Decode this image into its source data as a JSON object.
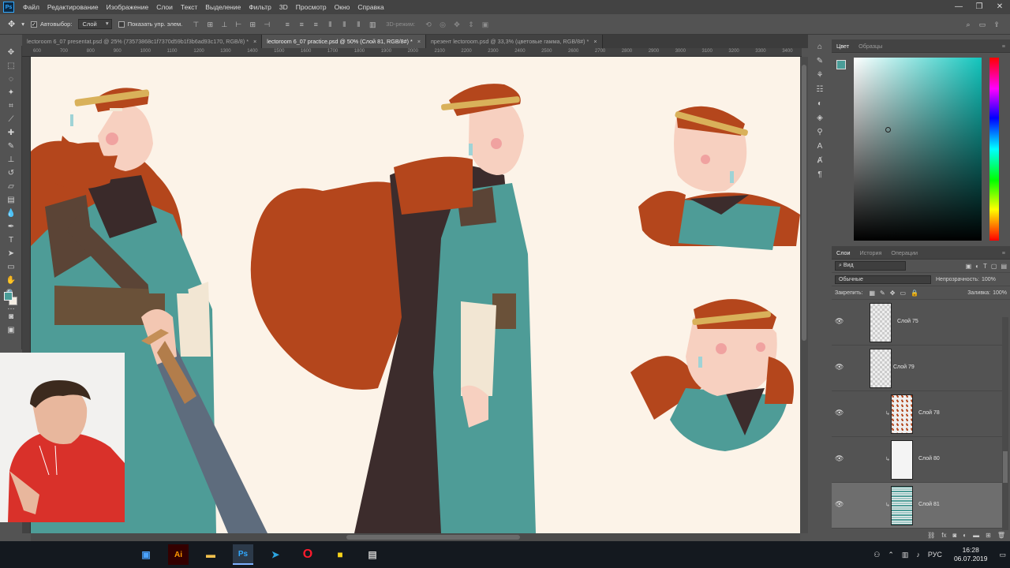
{
  "app": {
    "logo": "Ps"
  },
  "menu": [
    "Файл",
    "Редактирование",
    "Изображение",
    "Слои",
    "Текст",
    "Выделение",
    "Фильтр",
    "3D",
    "Просмотр",
    "Окно",
    "Справка"
  ],
  "window_controls": {
    "minimize": "—",
    "maximize": "❐",
    "close": "✕"
  },
  "options_bar": {
    "autoselect_label": "Автовыбор:",
    "autoselect_value": "Слой",
    "show_transform_label": "Показать упр. элем.",
    "mode_3d_label": "3D-режим:"
  },
  "tabs": [
    {
      "label": "lectoroom 6_07 presentat.psd @ 25% (73573868c1f7370d59b1f3b6ad93c170, RGB/8) *",
      "close": "×"
    },
    {
      "label": "lectoroom 6_07 practice.psd @ 50% (Слой 81, RGB/8#) *",
      "close": "×"
    },
    {
      "label": "презент lectoroom.psd @ 33,3% (цветовые гамма, RGB/8#) *",
      "close": "×"
    }
  ],
  "ruler_ticks": [
    "600",
    "700",
    "800",
    "900",
    "1000",
    "1100",
    "1200",
    "1300",
    "1400",
    "1500",
    "1600",
    "1700",
    "1800",
    "1900",
    "2000",
    "2100",
    "2200",
    "2300",
    "2400",
    "2500",
    "2600",
    "2700",
    "2800",
    "2900",
    "3000",
    "3100",
    "3200",
    "3300",
    "3400"
  ],
  "color_panel": {
    "tabs": [
      "Цвет",
      "Образцы"
    ],
    "fg_color": "#4a9d98",
    "bg_color": "#f4ede3",
    "hue_color": "#12c5bd"
  },
  "layers_panel": {
    "tabs": [
      "Слои",
      "История",
      "Операции"
    ],
    "filter_label": "Вид",
    "blend_mode": "Обычные",
    "opacity_label": "Непрозрачность:",
    "opacity_value": "100%",
    "lock_label": "Закрепить:",
    "fill_label": "Заливка:",
    "fill_value": "100%",
    "layers": [
      {
        "name": "Слой 75",
        "clipped": false,
        "active": false
      },
      {
        "name": "Слой 79",
        "clipped": false,
        "active": false
      },
      {
        "name": "Слой 78",
        "clipped": true,
        "active": false
      },
      {
        "name": "Слой 80",
        "clipped": true,
        "active": false
      },
      {
        "name": "Слой 81",
        "clipped": true,
        "active": true
      }
    ],
    "footer_icons": [
      "link-icon",
      "fx-icon",
      "mask-icon",
      "adjustment-icon",
      "folder-icon",
      "new-layer-icon",
      "trash-icon"
    ]
  },
  "taskbar": {
    "apps": [
      "explorer",
      "illustrator",
      "folder",
      "photoshop",
      "telegram",
      "opera",
      "sticky-notes",
      "app"
    ],
    "language": "РУС",
    "time": "16:28",
    "date": "06.07.2019"
  }
}
